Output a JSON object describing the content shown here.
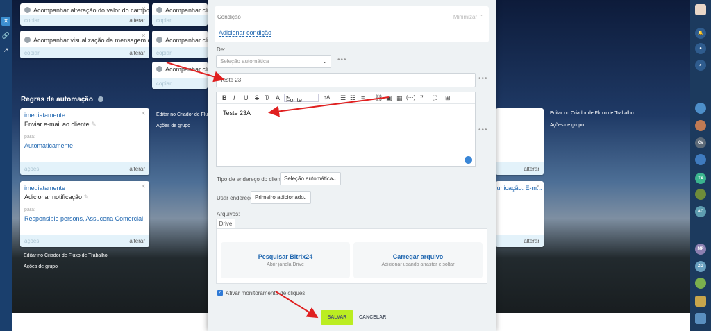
{
  "cards_top": {
    "c1": {
      "title": "Acompanhar alteração do valor do campo",
      "left": "copiar",
      "right": "alterar"
    },
    "c2": {
      "title": "Acompanhar cliqu",
      "left": "copiar"
    },
    "c3": {
      "title": "Acompanhar visualização da mensagem de",
      "left": "copiar",
      "right": "alterar"
    },
    "c4": {
      "title": "Acompanhar cliqu",
      "left": "copiar"
    },
    "c5": {
      "title": "Acompanhar cliqu",
      "left": "copiar"
    }
  },
  "section": {
    "title": "Regras de automação"
  },
  "rules": {
    "r1": {
      "trigger": "imediatamente",
      "action": "Enviar e-mail ao cliente",
      "para_label": "para:",
      "para_value": "Automaticamente",
      "left": "ações",
      "right": "alterar"
    },
    "r2": {
      "trigger": "imediatamente",
      "action": "Adicionar notificação",
      "para_label": "para:",
      "para_value": "Responsible persons, Assucena Comercial",
      "left": "ações",
      "right": "alterar"
    },
    "r3": {
      "right": "alterar"
    },
    "r4": {
      "trigger": "municação: E-m...",
      "right": "alterar"
    }
  },
  "side_links": {
    "edit": "Editar no Criador de Fluxo de Trabalho",
    "group": "Ações de grupo"
  },
  "modal": {
    "condition": {
      "label": "Condição",
      "minimize": "Minimizar",
      "add_label": "Adicionar condição"
    },
    "de_label": "De:",
    "de_select": "Seleção automática",
    "subject": "Teste 23",
    "font_label": "Fonte",
    "body": "Teste 23A",
    "address_type_label": "Tipo de endereço do cliente:",
    "address_type_value": "Seleção automática",
    "use_address_label": "Usar endereço:",
    "use_address_value": "Primeiro adicionado",
    "files_label": "Arquivos:",
    "drive_tab": "Drive",
    "search_title": "Pesquisar Bitrix24",
    "search_sub": "Abrir janela Drive",
    "upload_title": "Carregar arquivo",
    "upload_sub": "Adicionar usando arrastar e soltar",
    "track_label": "Ativar monitoramento de cliques",
    "save": "SALVAR",
    "cancel": "CANCELAR"
  },
  "rightbar_badges": [
    "CV",
    "TS",
    "AC",
    "MP",
    "ZG"
  ],
  "colors": {
    "accent": "#2067b0",
    "save_green": "#bbed21",
    "arrow_red": "#e02020"
  }
}
